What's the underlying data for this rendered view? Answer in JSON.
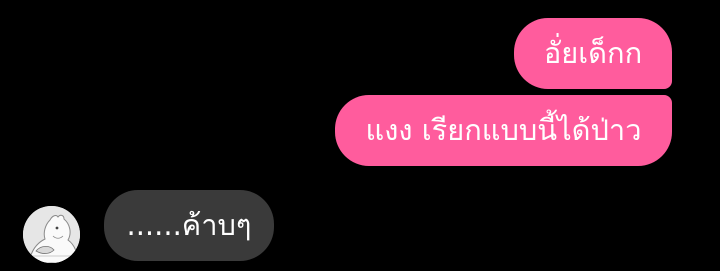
{
  "chat": {
    "messages": [
      {
        "direction": "outgoing",
        "text": "อั่ยเด็กก"
      },
      {
        "direction": "outgoing",
        "text": "แงง เรียกแบบนี้ได้ป่าว"
      },
      {
        "direction": "incoming",
        "text": "......ค้าบๆ"
      }
    ],
    "contact": {
      "avatar_icon": "moomin-avatar"
    }
  },
  "colors": {
    "background": "#000000",
    "outgoing_bubble": "#ff5c9d",
    "incoming_bubble": "#3a3a3a",
    "text": "#ffffff"
  }
}
